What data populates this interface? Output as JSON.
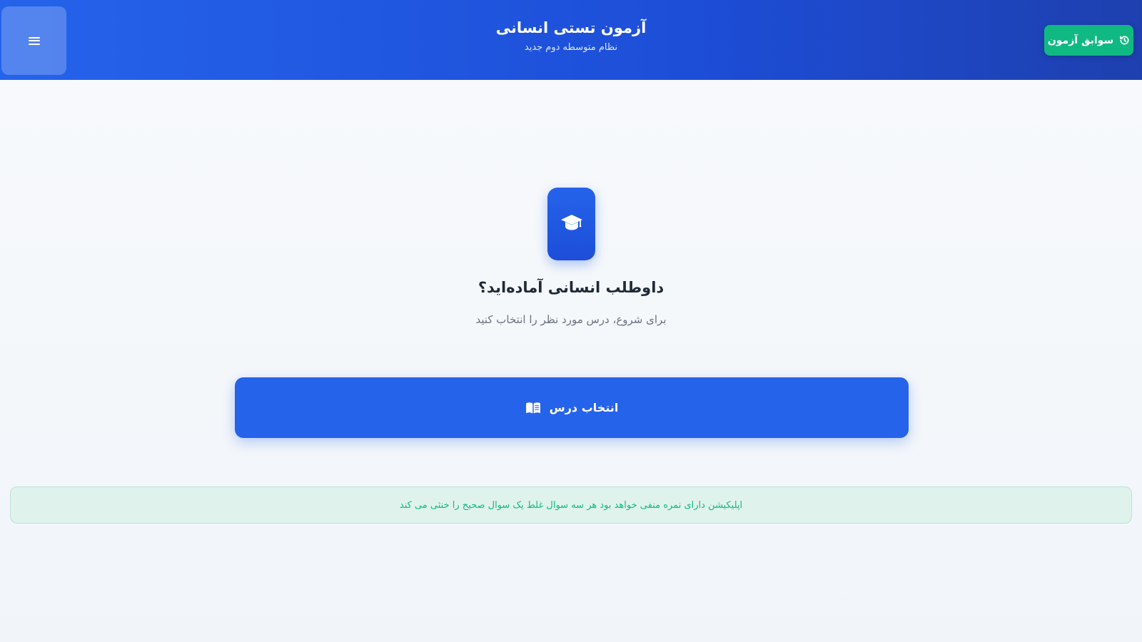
{
  "header": {
    "title": "آزمون تستی انسانی",
    "subtitle": "نظام متوسطه دوم جدید",
    "menu_icon": "hamburger-icon",
    "history_button": {
      "label": "سوابق آزمون",
      "icon": "history-icon"
    }
  },
  "hero": {
    "icon": "graduation-cap-icon",
    "title": "داوطلب انسانی آماده‌اید؟",
    "subtitle": "برای شروع، درس مورد نظر را انتخاب کنید"
  },
  "main": {
    "select_button": {
      "label": "انتخاب درس",
      "icon": "book-icon"
    }
  },
  "notice": {
    "text": "اپلیکیشن دارای نمره منفی خواهد بود هر سه سوال غلط یک سوال صحیح را خنثی می کند"
  },
  "colors": {
    "primary": "#2563eb",
    "header_gradient_end": "#1e40af",
    "success": "#10b981",
    "notice_bg": "#dff3ec",
    "page_bg": "#f8fafc"
  }
}
